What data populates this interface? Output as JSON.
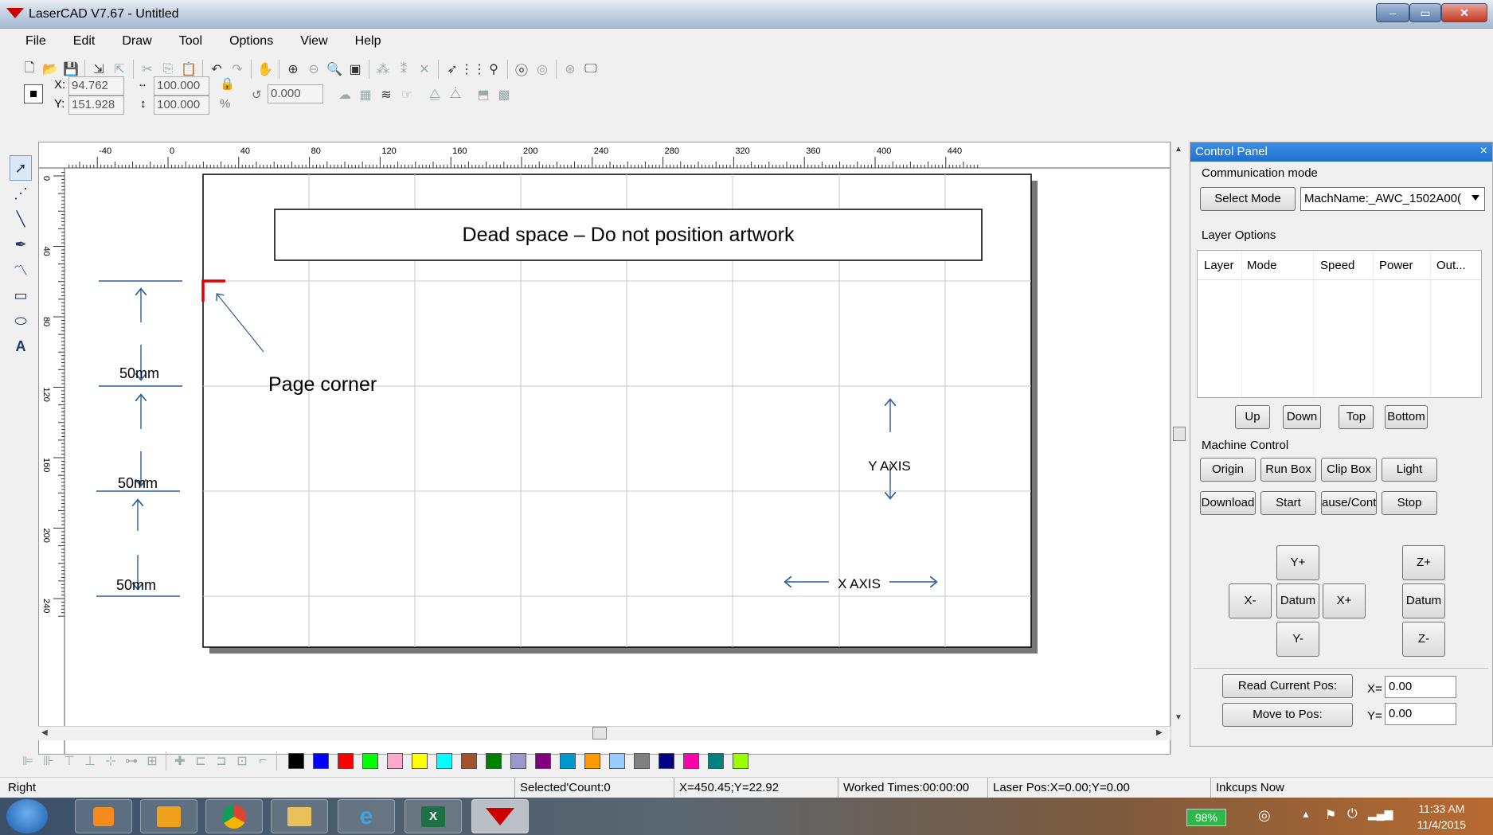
{
  "window": {
    "title": "LaserCAD V7.67 - Untitled",
    "controls": {
      "minimize": "–",
      "maximize": "▭",
      "close": "✕"
    }
  },
  "menu": [
    "File",
    "Edit",
    "Draw",
    "Tool",
    "Options",
    "View",
    "Help"
  ],
  "coords": {
    "x_label": "X:",
    "x_value": "94.762",
    "y_label": "Y:",
    "y_value": "151.928",
    "width_value": "100.000",
    "height_value": "100.000",
    "percent_label": "%",
    "rotate_value": "0.000"
  },
  "ruler": {
    "h_labels": [
      "-40",
      "0",
      "40",
      "80",
      "120",
      "160",
      "200",
      "240",
      "280",
      "320",
      "360",
      "400",
      "440"
    ],
    "v_labels": [
      "0",
      "40",
      "80",
      "120",
      "160",
      "200",
      "240"
    ]
  },
  "canvas": {
    "dead_space_text": "Dead space – Do not position artwork",
    "page_corner_text": "Page corner",
    "dimension_labels": [
      "50mm",
      "50mm",
      "50mm"
    ],
    "y_axis_label": "Y AXIS",
    "x_axis_label": "X AXIS",
    "page_corner_color": "#e00000",
    "annotation_color": "#2e5e99"
  },
  "control_panel": {
    "title": "Control Panel",
    "close": "×",
    "communication_mode": {
      "label": "Communication mode",
      "select_mode_button": "Select Mode",
      "machine_name": "MachName:_AWC_1502A00("
    },
    "layer_options": {
      "label": "Layer Options",
      "columns": [
        "Layer",
        "Mode",
        "Speed",
        "Power",
        "Out..."
      ],
      "buttons": [
        "Up",
        "Down",
        "Top",
        "Bottom"
      ]
    },
    "machine_control": {
      "label": "Machine Control",
      "row1": [
        "Origin",
        "Run Box",
        "Clip Box",
        "Light"
      ],
      "row2": [
        "Download",
        "Start",
        "ause/Continu",
        "Stop"
      ],
      "jog": {
        "y_plus": "Y+",
        "x_minus": "X-",
        "datum": "Datum",
        "x_plus": "X+",
        "y_minus": "Y-",
        "z_plus": "Z+",
        "z_datum": "Datum",
        "z_minus": "Z-"
      }
    },
    "position": {
      "read_button": "Read Current Pos:",
      "move_button": "Move to Pos:",
      "x_label": "X=",
      "x_value": "0.00",
      "y_label": "Y=",
      "y_value": "0.00"
    }
  },
  "palette": [
    "#000000",
    "#0000ff",
    "#ff0000",
    "#00ff00",
    "#ffaacc",
    "#ffff00",
    "#00ffff",
    "#a0522d",
    "#008000",
    "#9999cc",
    "#800080",
    "#0099cc",
    "#ff9900",
    "#99ccff",
    "#808080",
    "#000080",
    "#ff00aa",
    "#008080",
    "#99ff00"
  ],
  "status": {
    "left": "Right",
    "selected": "Selected'Count:0",
    "cursor": "X=450.45;Y=22.92",
    "worked": "Worked Times:00:00:00",
    "laser_pos": "Laser Pos:X=0.00;Y=0.00",
    "company": "Inkcups Now"
  },
  "taskbar": {
    "battery": "98%",
    "time": "11:33 AM",
    "date": "11/4/2015"
  }
}
